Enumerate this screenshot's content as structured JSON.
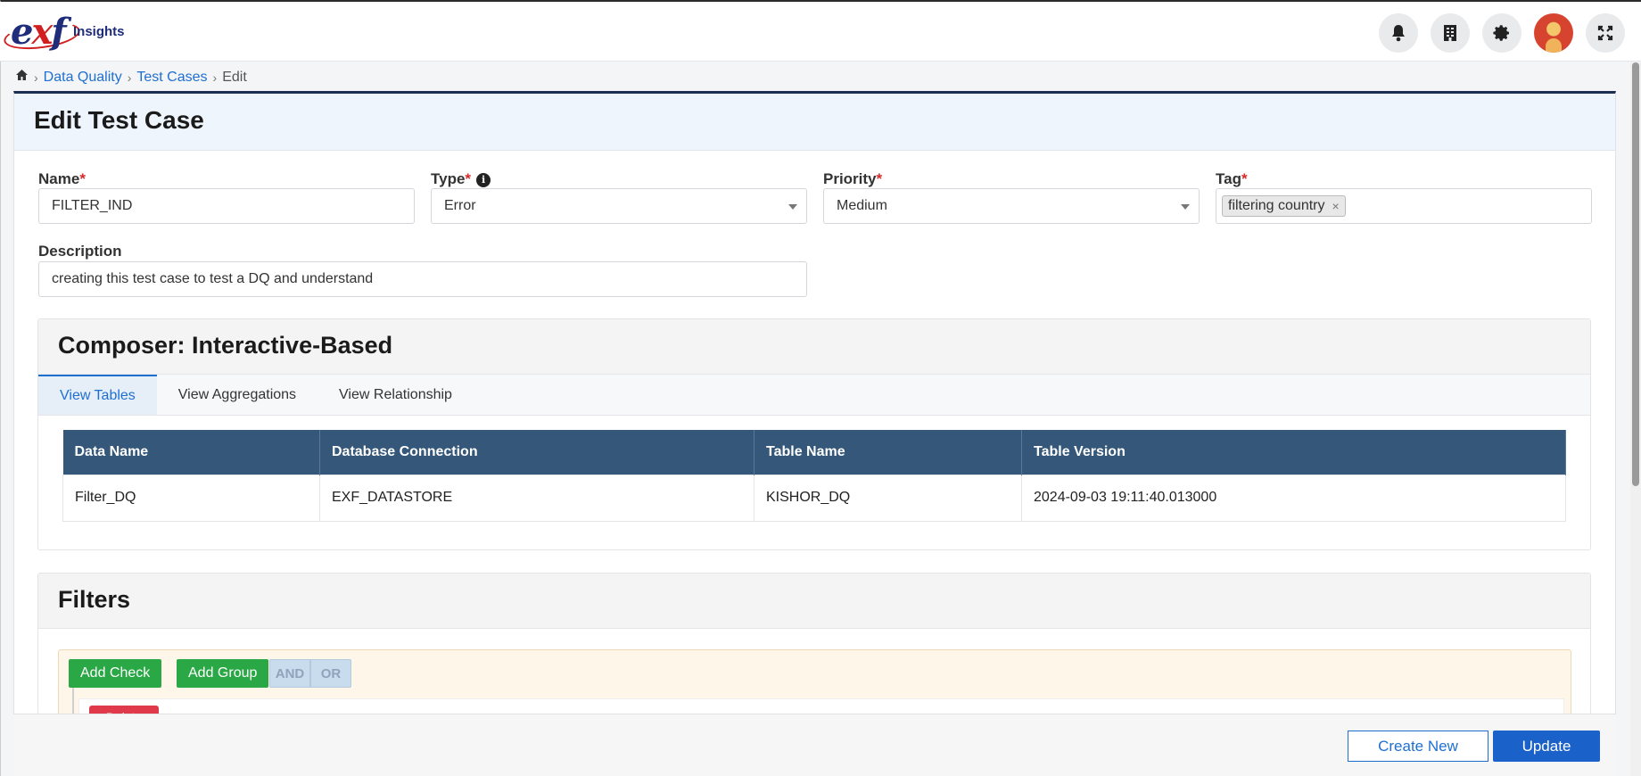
{
  "app": {
    "logo_main": "exf",
    "logo_sub": "Insights"
  },
  "header": {
    "icons": [
      "bell-icon",
      "building-icon",
      "gear-icon",
      "user-avatar",
      "expand-icon"
    ]
  },
  "breadcrumb": {
    "items": [
      "Data Quality",
      "Test Cases",
      "Edit"
    ]
  },
  "page": {
    "title": "Edit Test Case"
  },
  "form": {
    "name_label": "Name",
    "name_value": "FILTER_IND",
    "type_label": "Type",
    "type_value": "Error",
    "priority_label": "Priority",
    "priority_value": "Medium",
    "tag_label": "Tag",
    "tag_value": "filtering country",
    "required_mark": "*",
    "description_label": "Description",
    "description_value": "creating this test case to test a DQ and understand"
  },
  "composer": {
    "title": "Composer: Interactive-Based",
    "tabs": [
      "View Tables",
      "View Aggregations",
      "View Relationship"
    ],
    "active_tab": "View Tables",
    "table": {
      "columns": [
        "Data Name",
        "Database Connection",
        "Table Name",
        "Table Version"
      ],
      "rows": [
        [
          "Filter_DQ",
          "EXF_DATASTORE",
          "KISHOR_DQ",
          "2024-09-03 19:11:40.013000"
        ]
      ]
    }
  },
  "filters": {
    "title": "Filters",
    "add_check": "Add Check",
    "add_group": "Add Group",
    "and_label": "AND",
    "or_label": "OR",
    "delete_label": "Delete"
  },
  "footer": {
    "create_new": "Create New",
    "update": "Update"
  },
  "colors": {
    "accent": "#1f6fd1",
    "table_header": "#35587a",
    "green": "#2aa845",
    "danger": "#e03a4a"
  }
}
